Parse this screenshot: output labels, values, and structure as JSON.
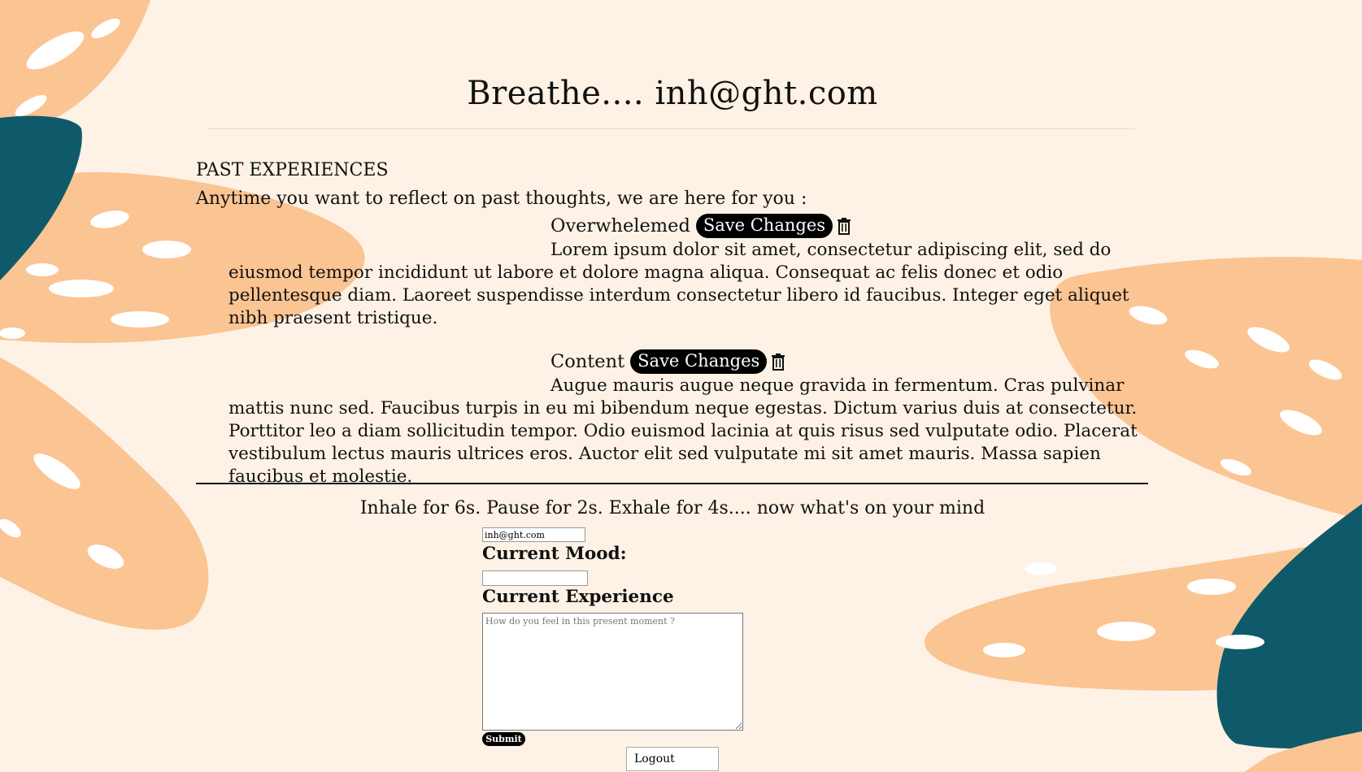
{
  "header": {
    "title": "Breathe.... inh@ght.com"
  },
  "past": {
    "heading": "PAST EXPERIENCES",
    "intro": "Anytime you want to reflect on past thoughts, we are here for you :",
    "entries": [
      {
        "mood": "Overwhelemed",
        "save_label": "Save Changes",
        "delete_icon": "trash-icon",
        "text": "Lorem ipsum dolor sit amet, consectetur adipiscing elit, sed do eiusmod tempor incididunt ut labore et dolore magna aliqua. Consequat ac felis donec et odio pellentesque diam. Laoreet suspendisse interdum consectetur libero id faucibus. Integer eget aliquet nibh praesent tristique."
      },
      {
        "mood": "Content",
        "save_label": "Save Changes",
        "delete_icon": "trash-icon",
        "text": "Augue mauris augue neque gravida in fermentum. Cras pulvinar mattis nunc sed. Faucibus turpis in eu mi bibendum neque egestas. Dictum varius duis at consectetur. Porttitor leo a diam sollicitudin tempor. Odio euismod lacinia at quis risus sed vulputate odio. Placerat vestibulum lectus mauris ultrices eros. Auctor elit sed vulputate mi sit amet mauris. Massa sapien faucibus et molestie."
      }
    ]
  },
  "form": {
    "prompt": "Inhale for 6s. Pause for 2s. Exhale for 4s.... now what's on your mind",
    "email_value": "inh@ght.com",
    "mood_label": "Current Mood:",
    "mood_value": "",
    "experience_label": "Current Experience",
    "experience_placeholder": "How do you feel in this present moment ?",
    "submit_label": "Submit"
  },
  "logout_label": "Logout",
  "colors": {
    "background": "#fdf2e5",
    "leaf_peach": "#fbc493",
    "leaf_teal": "#0e5a6a",
    "spots": "#ffffff"
  }
}
